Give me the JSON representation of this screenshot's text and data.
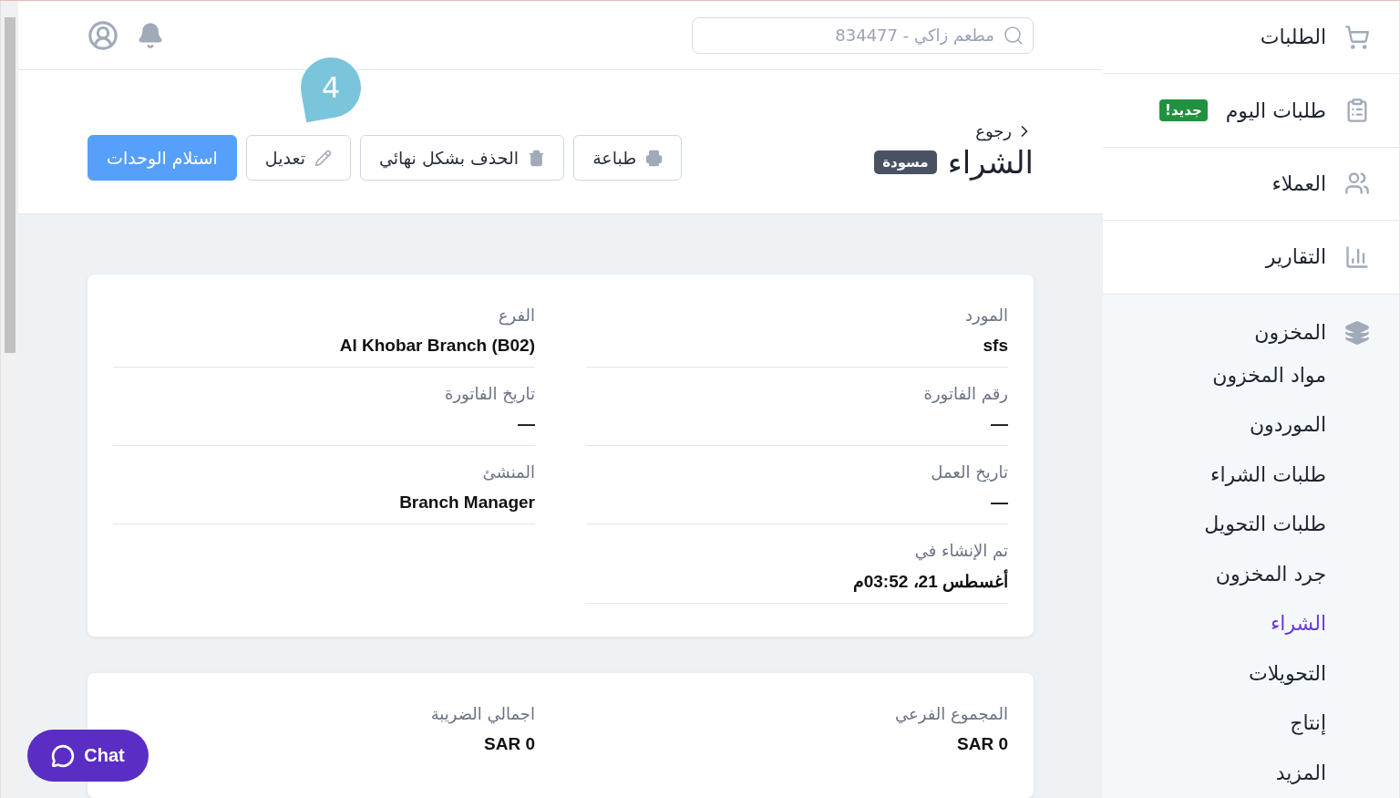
{
  "sidebar": {
    "items": [
      {
        "label": "الطلبات",
        "selected": false
      },
      {
        "label": "طلبات اليوم",
        "badge": "جديد!",
        "selected": false
      },
      {
        "label": "العملاء",
        "selected": false
      },
      {
        "label": "التقارير",
        "selected": false
      }
    ],
    "group": {
      "label": "المخزون",
      "expanded": true,
      "children": [
        {
          "label": "مواد المخزون",
          "selected": false
        },
        {
          "label": "الموردون",
          "selected": false
        },
        {
          "label": "طلبات الشراء",
          "selected": false
        },
        {
          "label": "طلبات التحويل",
          "selected": false
        },
        {
          "label": "جرد المخزون",
          "selected": false
        },
        {
          "label": "الشراء",
          "selected": true
        },
        {
          "label": "التحويلات",
          "selected": false
        },
        {
          "label": "إنتاج",
          "selected": false
        },
        {
          "label": "المزيد",
          "selected": false
        }
      ]
    }
  },
  "search": {
    "placeholder": "مطعم زاكي - 834477"
  },
  "header": {
    "back": "رجوع",
    "title": "الشراء",
    "status": "مسودة",
    "buttons": [
      {
        "label": "طباعة",
        "kind": "print"
      },
      {
        "label": "الحذف بشكل نهائي",
        "kind": "delete"
      },
      {
        "label": "تعديل",
        "kind": "edit"
      },
      {
        "label": "استلام الوحدات",
        "kind": "primary"
      }
    ],
    "step_marker": "4"
  },
  "details": [
    {
      "label": "المورد",
      "value": "sfs"
    },
    {
      "label": "الفرع",
      "value": "Al Khobar Branch (B02)"
    },
    {
      "label": "رقم الفاتورة",
      "value": "—"
    },
    {
      "label": "تاريخ الفاتورة",
      "value": "—"
    },
    {
      "label": "تاريخ العمل",
      "value": "—"
    },
    {
      "label": "المنشئ",
      "value": "Branch Manager"
    },
    {
      "label": "تم الإنشاء في",
      "value": "أغسطس 21، 03:52م"
    }
  ],
  "totals": [
    {
      "label": "المجموع الفرعي",
      "value": "SAR 0"
    },
    {
      "label": "اجمالي الضريبة",
      "value": "SAR 0"
    }
  ],
  "chat": {
    "label": "Chat"
  }
}
